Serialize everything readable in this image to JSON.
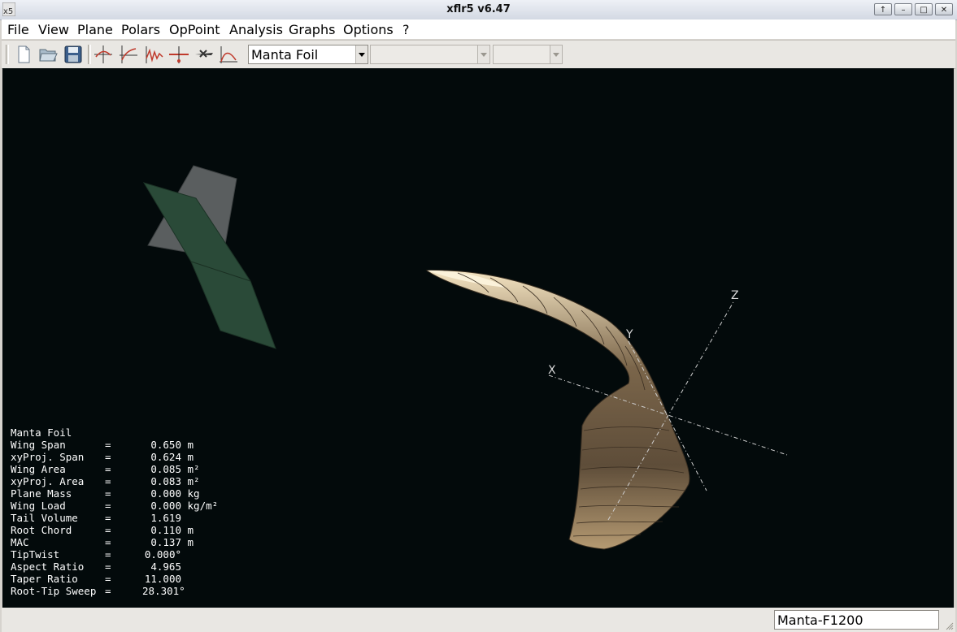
{
  "window": {
    "title": "xflr5 v6.47",
    "buttons": [
      "↑",
      "–",
      "□",
      "✕"
    ]
  },
  "menu": [
    "File",
    "View",
    "Plane",
    "Polars",
    "OpPoint",
    "Analysis",
    "Graphs",
    "Options",
    "?"
  ],
  "toolbar": {
    "icons": [
      "new-file-icon",
      "open-file-icon",
      "save-icon",
      "foil-design-icon",
      "xfoil-direct-icon",
      "inverse-design-icon",
      "airfoil-analysis-icon",
      "plane-design-icon",
      "wing-analysis-icon"
    ],
    "plane_select": "Manta Foil",
    "polar_select": "",
    "oppoint_select": ""
  },
  "viewport": {
    "axis_labels": [
      "X",
      "Y",
      "Z"
    ],
    "plane_info": {
      "name": "Manta Foil",
      "rows": [
        {
          "label": "Wing Span",
          "value": "0.650",
          "unit": "m"
        },
        {
          "label": "xyProj. Span",
          "value": "0.624",
          "unit": "m"
        },
        {
          "label": "Wing Area",
          "value": "0.085",
          "unit": "m²"
        },
        {
          "label": "xyProj. Area",
          "value": "0.083",
          "unit": "m²"
        },
        {
          "label": "Plane Mass",
          "value": "0.000",
          "unit": "kg"
        },
        {
          "label": "Wing Load",
          "value": "0.000",
          "unit": "kg/m²"
        },
        {
          "label": "Tail Volume",
          "value": "1.619",
          "unit": ""
        },
        {
          "label": "Root Chord",
          "value": "0.110",
          "unit": "m"
        },
        {
          "label": "MAC",
          "value": "0.137",
          "unit": "m"
        },
        {
          "label": "TipTwist",
          "value": "0.000°",
          "unit": ""
        },
        {
          "label": "Aspect Ratio",
          "value": "4.965",
          "unit": ""
        },
        {
          "label": "Taper Ratio",
          "value": "11.000",
          "unit": ""
        },
        {
          "label": "Root-Tip Sweep",
          "value": "28.301°",
          "unit": ""
        }
      ]
    }
  },
  "status": {
    "plane_name": "Manta-F1200"
  },
  "colors": {
    "viewport_bg": "#030a0b",
    "wing_surface": "#8c7350",
    "elevator": "#2a4a38",
    "fin": "#5a5e5f"
  }
}
